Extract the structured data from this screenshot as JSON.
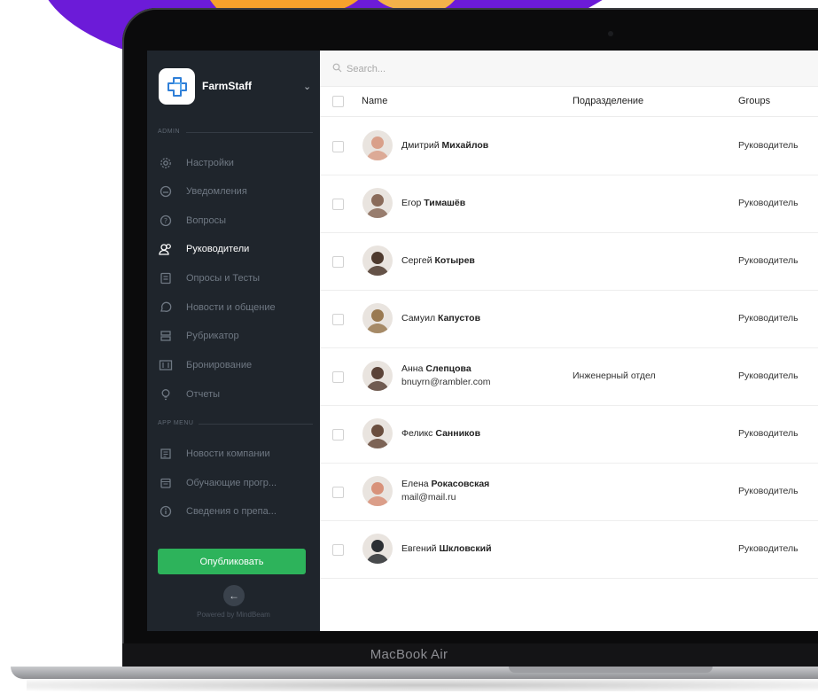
{
  "device_label": "MacBook Air",
  "sidebar": {
    "app_name": "FarmStaff",
    "sections": {
      "admin": "ADMIN",
      "app_menu": "APP MENU"
    },
    "admin_items": [
      {
        "label": "Настройки",
        "icon": "gear-icon"
      },
      {
        "label": "Уведомления",
        "icon": "bell-icon"
      },
      {
        "label": "Вопросы",
        "icon": "question-icon"
      },
      {
        "label": "Руководители",
        "icon": "users-icon",
        "active": true
      },
      {
        "label": "Опросы и Тесты",
        "icon": "survey-icon"
      },
      {
        "label": "Новости и общение",
        "icon": "chat-icon"
      },
      {
        "label": "Рубрикатор",
        "icon": "rubric-icon"
      },
      {
        "label": "Бронирование",
        "icon": "booking-icon"
      },
      {
        "label": "Отчеты",
        "icon": "bulb-icon"
      }
    ],
    "app_items": [
      {
        "label": "Новости компании",
        "icon": "news-icon"
      },
      {
        "label": "Обучающие прогр...",
        "icon": "calendar-icon"
      },
      {
        "label": "Сведения о препа...",
        "icon": "info-icon"
      }
    ],
    "publish_label": "Опубликовать",
    "powered_by": "Powered by MindBeam"
  },
  "search": {
    "placeholder": "Search..."
  },
  "table": {
    "headers": {
      "name": "Name",
      "department": "Подразделение",
      "groups": "Groups"
    },
    "rows": [
      {
        "first": "Дмитрий",
        "last": "Михайлов",
        "email": "",
        "department": "",
        "group": "Руководитель",
        "avatar_color": "#d9a08a"
      },
      {
        "first": "Егор",
        "last": "Тимашёв",
        "email": "",
        "department": "",
        "group": "Руководитель",
        "avatar_color": "#8a6b5a"
      },
      {
        "first": "Сергей",
        "last": "Котырев",
        "email": "",
        "department": "",
        "group": "Руководитель",
        "avatar_color": "#4e3a2e"
      },
      {
        "first": "Самуил",
        "last": "Капустов",
        "email": "",
        "department": "",
        "group": "Руководитель",
        "avatar_color": "#9a7a52"
      },
      {
        "first": "Анна",
        "last": "Слепцова",
        "email": "bnuyrn@rambler.com",
        "department": "Инженерный отдел",
        "group": "Руководитель",
        "avatar_color": "#5b4338"
      },
      {
        "first": "Феликс",
        "last": "Санников",
        "email": "",
        "department": "",
        "group": "Руководитель",
        "avatar_color": "#6a4e3e"
      },
      {
        "first": "Елена",
        "last": "Рокасовская",
        "email": "mail@mail.ru",
        "department": "",
        "group": "Руководитель",
        "avatar_color": "#d8927a"
      },
      {
        "first": "Евгений",
        "last": "Шкловский",
        "email": "",
        "department": "",
        "group": "Руководитель",
        "avatar_color": "#2c2f33"
      }
    ]
  },
  "colors": {
    "sidebar_bg": "#1f252c",
    "accent_green": "#2db35b",
    "brand_purple": "#6c1bd8",
    "brand_orange": "#f7a12c"
  }
}
